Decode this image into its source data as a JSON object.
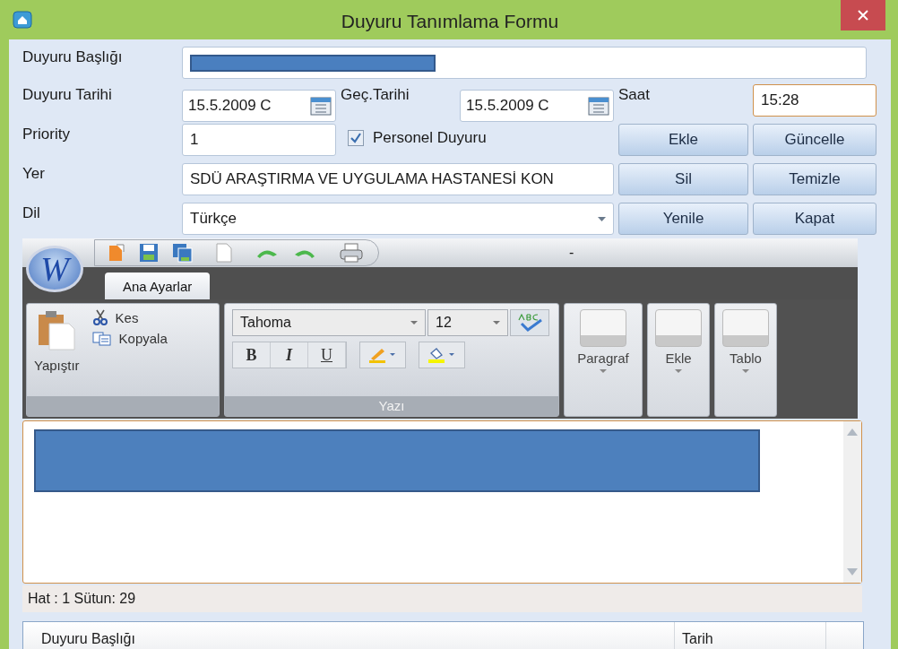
{
  "window": {
    "title": "Duyuru Tanımlama Formu"
  },
  "form": {
    "title_label": "Duyuru Başlığı",
    "date_label": "Duyuru Tarihi",
    "date_value": "15.5.2009 C",
    "expiry_label": "Geç.Tarihi",
    "expiry_value": "15.5.2009 C",
    "time_label": "Saat",
    "time_value": "15:28",
    "priority_label": "Priority",
    "priority_value": "1",
    "personal": {
      "label": "Personel Duyuru",
      "checked": true
    },
    "place_label": "Yer",
    "place_value": "SDÜ ARAŞTIRMA VE UYGULAMA HASTANESİ KON",
    "language_label": "Dil",
    "language_value": "Türkçe"
  },
  "buttons": [
    "Ekle",
    "Güncelle",
    "Sil",
    "Temizle",
    "Yenile",
    "Kapat"
  ],
  "ribbon": {
    "logo_letter": "W",
    "title_text": "-",
    "tab": {
      "label": "Ana Ayarlar",
      "selected": true
    },
    "clipboard": {
      "paste": "Yapıştır",
      "cut": "Kes",
      "copy": "Kopyala"
    },
    "font": {
      "family": "Tahoma",
      "size": "12",
      "group_label": "Yazı",
      "format_buttons": [
        "B",
        "I",
        "U"
      ]
    },
    "groups": [
      "Paragraf",
      "Ekle",
      "Tablo"
    ]
  },
  "status": "Hat : 1 Sütun: 29",
  "grid": {
    "columns": [
      "Duyuru Başlığı",
      "Tarih"
    ]
  }
}
